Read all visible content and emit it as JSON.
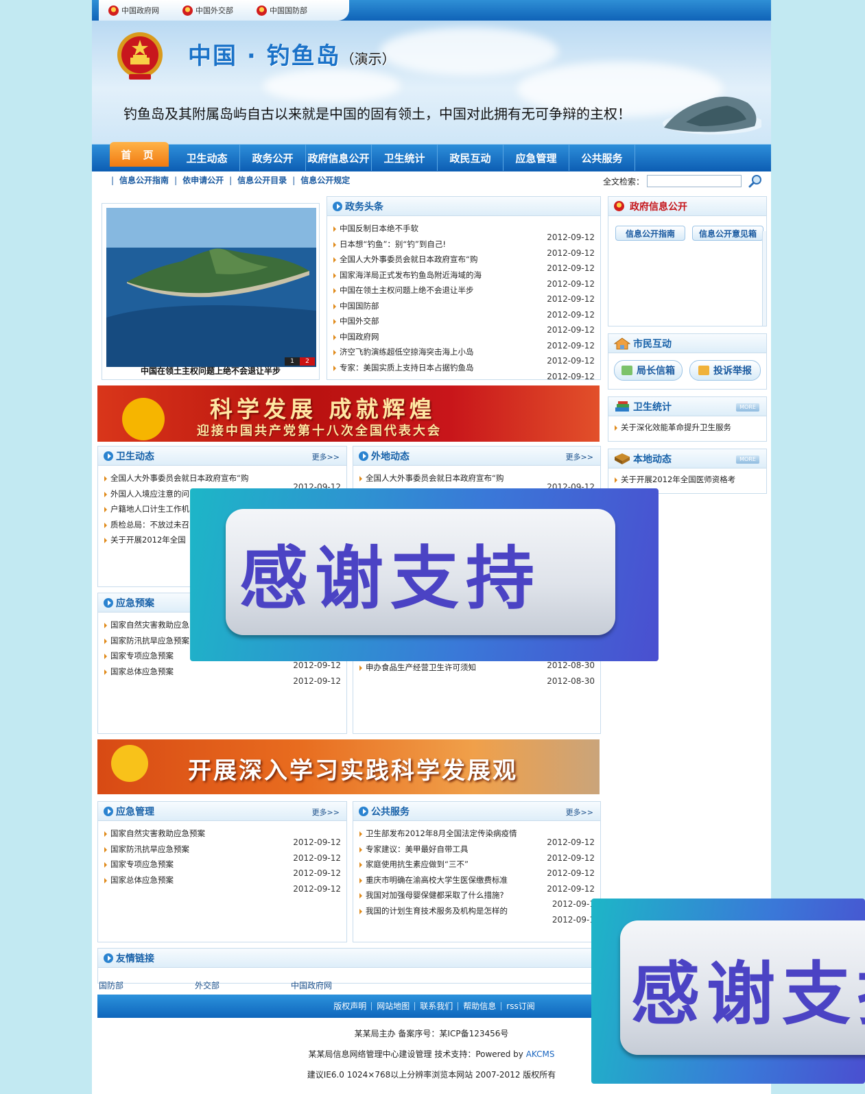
{
  "top_links": [
    "中国政府网",
    "中国外交部",
    "中国国防部"
  ],
  "header": {
    "title": "中国 · 钓鱼岛",
    "subtitle": "（演示）",
    "slogan": "钓鱼岛及其附属岛屿自古以来就是中国的固有领土，中国对此拥有无可争辩的主权！"
  },
  "nav": {
    "home": "首 页",
    "items": [
      "卫生动态",
      "政务公开",
      "政府信息公开",
      "卫生统计",
      "政民互动",
      "应急管理",
      "公共服务"
    ]
  },
  "subnav": [
    "信息公开指南",
    "依申请公开",
    "信息公开目录",
    "信息公开规定"
  ],
  "search": {
    "label": "全文检索：",
    "value": ""
  },
  "photo": {
    "caption": "中国在领土主权问题上绝不会退让半步",
    "pages": [
      "1",
      "2"
    ]
  },
  "headlines": {
    "title": "政务头条",
    "items": [
      "中国反制日本绝不手软",
      "日本想“钓鱼”：别“钓”到自己!",
      "全国人大外事委员会就日本政府宣布“购",
      "国家海洋局正式发布钓鱼岛附近海域的海",
      "中国在领土主权问题上绝不会退让半步",
      "中国国防部",
      "中国外交部",
      "中国政府网",
      "济空飞豹演练超低空掠海突击海上小岛",
      "专家：美国实质上支持日本占据钓鱼岛"
    ],
    "dates": [
      "2012-09-12",
      "2012-09-12",
      "2012-09-12",
      "2012-09-12",
      "2012-09-12",
      "2012-09-12",
      "2012-09-12",
      "2012-09-12",
      "2012-09-12",
      "2012-09-12"
    ]
  },
  "banner1": {
    "line1": "科学发展 成就辉煌",
    "line2": "迎接中国共产党第十八次全国代表大会"
  },
  "banner2": {
    "text": "开展深入学习实践科学发展观"
  },
  "more_label": "更多>>",
  "health_news": {
    "title": "卫生动态",
    "items": [
      "全国人大外事委员会就日本政府宣布“购",
      "外国人入境应注意的问",
      "户籍地人口计生工作机",
      "质检总局：不放过未召",
      "关于开展2012年全国"
    ],
    "dates": [
      "2012-09-12"
    ]
  },
  "external_news": {
    "title": "外地动态",
    "items": [
      "全国人大外事委员会就日本政府宣布“购"
    ],
    "dates": [
      "2012-09-12"
    ]
  },
  "emergency_plans": {
    "title": "应急预案",
    "items": [
      "国家自然灾害救助应急",
      "国家防汛抗旱应急预案",
      "国家专项应急预案",
      "国家总体应急预案"
    ],
    "dates": [
      "2012-09-12",
      "2012-09-12"
    ]
  },
  "mid_right_list": {
    "items": [
      "申办食品生产经营卫生许可须知"
    ],
    "dates": [
      "2012-08-30",
      "2012-08-30"
    ]
  },
  "emergency_mgmt": {
    "title": "应急管理",
    "items": [
      "国家自然灾害救助应急预案",
      "国家防汛抗旱应急预案",
      "国家专项应急预案",
      "国家总体应急预案"
    ],
    "dates": [
      "2012-09-12",
      "2012-09-12",
      "2012-09-12",
      "2012-09-12"
    ]
  },
  "public_service": {
    "title": "公共服务",
    "items": [
      "卫生部发布2012年8月全国法定传染病疫情",
      "专家建议：美甲最好自带工具",
      "家庭使用抗生素应做到“三不”",
      "重庆市明确在渝高校大学生医保缴费标准",
      "我国对加强母婴保健都采取了什么措施?",
      "我国的计划生育技术服务及机构是怎样的"
    ],
    "dates": [
      "2012-09-12",
      "2012-09-12",
      "2012-09-12",
      "2012-09-12",
      "2012-09-1",
      "2012-09-1"
    ]
  },
  "gov_info": {
    "title": "政府信息公开",
    "buttons": [
      "信息公开指南",
      "信息公开意见箱"
    ]
  },
  "citizen": {
    "title": "市民互动",
    "buttons": [
      "局长信箱",
      "投诉举报"
    ]
  },
  "health_stats": {
    "title": "卫生统计",
    "items": [
      "关于深化效能革命提升卫生服务"
    ]
  },
  "local_news": {
    "title": "本地动态",
    "items": [
      "关于开展2012年全国医师资格考"
    ]
  },
  "more_badge": "MORE",
  "friend_links": {
    "title": "友情链接",
    "items": [
      "国防部",
      "外交部",
      "中国政府网"
    ]
  },
  "footer": {
    "links": [
      "版权声明",
      "网站地图",
      "联系我们",
      "帮助信息",
      "rss订阅"
    ],
    "line1": "某某局主办  备案序号：某ICP备123456号",
    "line2_prefix": "某某局信息网络管理中心建设管理  技术支持：Powered by ",
    "line2_link": "AKCMS",
    "line3": "建议IE6.0 1024×768以上分辨率浏览本网站  2007-2012 版权所有"
  },
  "popup": {
    "text": "感谢支持"
  }
}
